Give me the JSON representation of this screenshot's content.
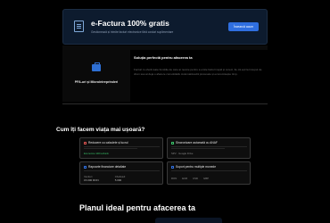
{
  "banner": {
    "title": "e-Factura 100% gratis",
    "subtitle": "Gestionează și trimite facturi electronice fără costuri suplimentare",
    "cta_label": "Încearcă acum"
  },
  "feature": {
    "label": "PFA-uri și Microîntreprinderi",
    "icon": "briefcase-icon"
  },
  "solution": {
    "title": "Soluția perfectă pentru afacerea ta",
    "text": "Facturi.ro oferă toate funcțiile de care ai nevoie pentru a emite facturi rapid și corect, fie că ești la început de drum sau ai deja o afacere consolidată. Automatizează procesele și economisește timp."
  },
  "benefits": {
    "title": "Cum îți facem viața mai ușoară?",
    "cards": [
      {
        "title": "Reducere cu calculele și lucrul",
        "icon": "document-icon",
        "badge": "Economie 100 lei/lună",
        "badge_color": "#39c46a"
      },
      {
        "title": "Sincronizare automată cu ANAF",
        "icon": "sync-icon",
        "badge": "SPV  ·  Google Drive",
        "badge_color": "#8a8a8a"
      },
      {
        "title": "Rapoarte financiare detaliate",
        "icon": "chart-icon",
        "stat_a_label": "Venituri",
        "stat_a_value": "15.000 RON",
        "stat_b_label": "Cheltuieli",
        "stat_b_value": "5.000"
      },
      {
        "title": "Suport pentru multiple monede",
        "icon": "currency-icon",
        "currencies": [
          "RON",
          "EUR",
          "USD",
          "GBP"
        ]
      }
    ]
  },
  "plans": {
    "title": "Planul ideal pentru afacerea ta"
  },
  "colors": {
    "accent": "#2f6fe0",
    "success": "#39c46a",
    "background": "#000000"
  }
}
